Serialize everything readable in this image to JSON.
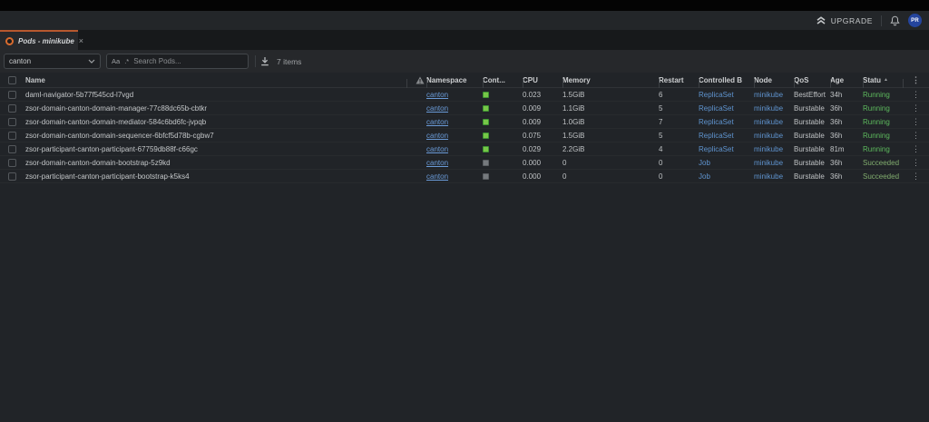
{
  "topbar": {
    "upgrade_label": "UPGRADE",
    "avatar_initials": "PR"
  },
  "tab": {
    "title": "Pods - minikube"
  },
  "filters": {
    "namespace_selected": "canton",
    "match_case_toggle": "Aa",
    "regex_toggle": ".*",
    "search_placeholder": "Search Pods...",
    "items_count": "7 items"
  },
  "icons": {
    "close": "×",
    "kebab": "⋮",
    "sort_asc": "▲"
  },
  "table": {
    "headers": {
      "name": "Name",
      "namespace": "Namespace",
      "containers": "Cont...",
      "cpu": "CPU",
      "memory": "Memory",
      "restarts": "Restart",
      "controlled_by": "Controlled B",
      "node": "Node",
      "qos": "QoS",
      "age": "Age",
      "status": "Statu"
    },
    "rows": [
      {
        "name": "daml-navigator-5b77f545cd-l7vgd",
        "namespace": "canton",
        "container_state": "running",
        "cpu": "0.023",
        "memory": "1.5GiB",
        "restarts": "6",
        "controlled_by": "ReplicaSet",
        "node": "minikube",
        "qos": "BestEffort",
        "age": "34h",
        "status": "Running"
      },
      {
        "name": "zsor-domain-canton-domain-manager-77c88dc65b-cbtkr",
        "namespace": "canton",
        "container_state": "running",
        "cpu": "0.009",
        "memory": "1.1GiB",
        "restarts": "5",
        "controlled_by": "ReplicaSet",
        "node": "minikube",
        "qos": "Burstable",
        "age": "36h",
        "status": "Running"
      },
      {
        "name": "zsor-domain-canton-domain-mediator-584c6bd6fc-jvpqb",
        "namespace": "canton",
        "container_state": "running",
        "cpu": "0.009",
        "memory": "1.0GiB",
        "restarts": "7",
        "controlled_by": "ReplicaSet",
        "node": "minikube",
        "qos": "Burstable",
        "age": "36h",
        "status": "Running"
      },
      {
        "name": "zsor-domain-canton-domain-sequencer-6bfcf5d78b-cgbw7",
        "namespace": "canton",
        "container_state": "running",
        "cpu": "0.075",
        "memory": "1.5GiB",
        "restarts": "5",
        "controlled_by": "ReplicaSet",
        "node": "minikube",
        "qos": "Burstable",
        "age": "36h",
        "status": "Running"
      },
      {
        "name": "zsor-participant-canton-participant-67759db88f-c66gc",
        "namespace": "canton",
        "container_state": "running",
        "cpu": "0.029",
        "memory": "2.2GiB",
        "restarts": "4",
        "controlled_by": "ReplicaSet",
        "node": "minikube",
        "qos": "Burstable",
        "age": "81m",
        "status": "Running"
      },
      {
        "name": "zsor-domain-canton-domain-bootstrap-5z9kd",
        "namespace": "canton",
        "container_state": "succeeded",
        "cpu": "0.000",
        "memory": "0",
        "restarts": "0",
        "controlled_by": "Job",
        "node": "minikube",
        "qos": "Burstable",
        "age": "36h",
        "status": "Succeeded"
      },
      {
        "name": "zsor-participant-canton-participant-bootstrap-k5ks4",
        "namespace": "canton",
        "container_state": "succeeded",
        "cpu": "0.000",
        "memory": "0",
        "restarts": "0",
        "controlled_by": "Job",
        "node": "minikube",
        "qos": "Burstable",
        "age": "36h",
        "status": "Succeeded"
      }
    ]
  },
  "colors": {
    "accent_orange": "#d96c2f",
    "link_blue": "#5f94cf",
    "running_green": "#5dba5d",
    "succeeded_green": "#81ad6e",
    "avatar_blue": "#24459e"
  }
}
